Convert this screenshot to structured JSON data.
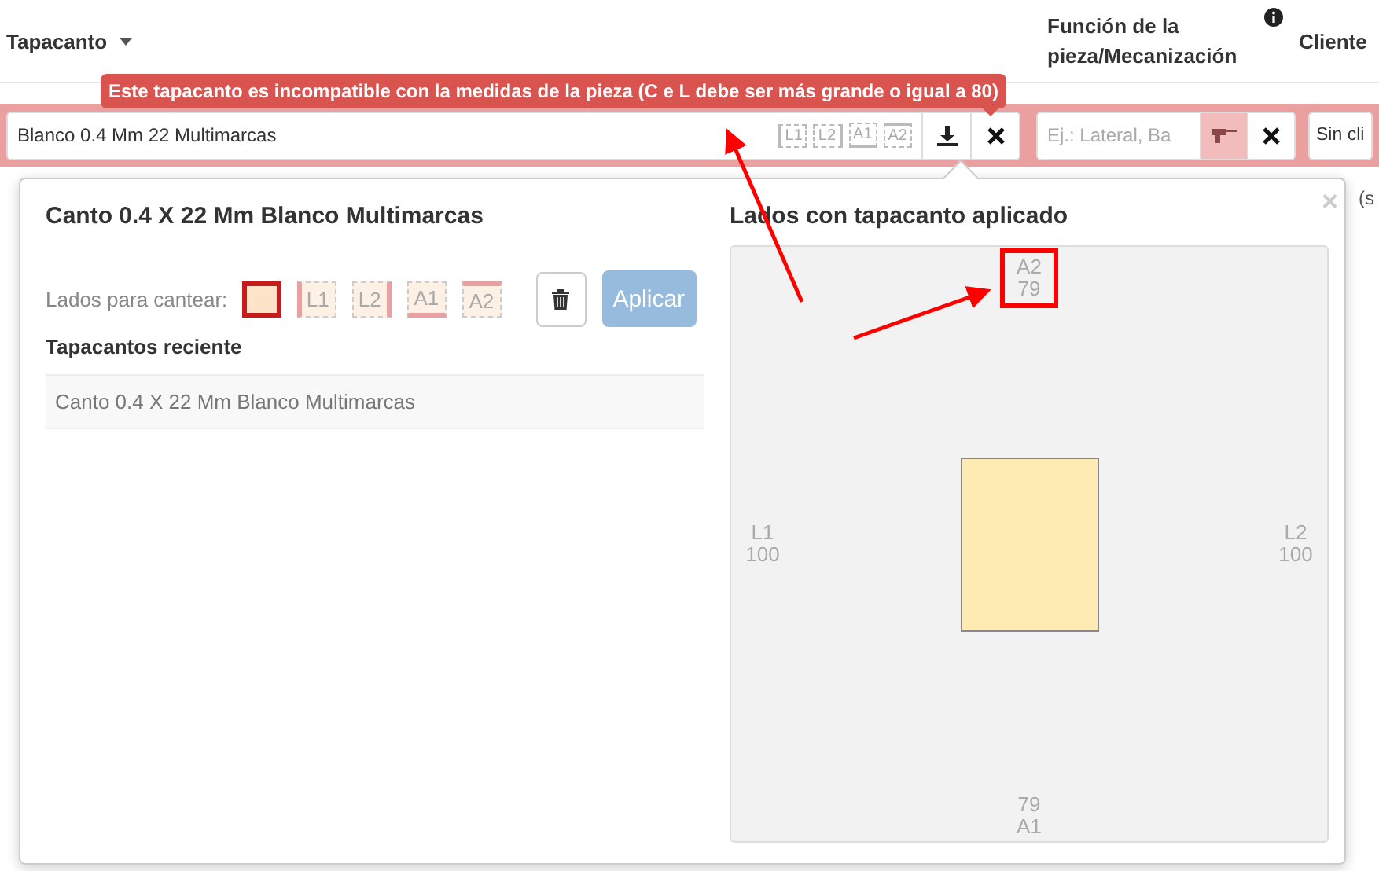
{
  "header": {
    "columns": [
      {
        "label": "Tapacanto",
        "kind": "sortable"
      },
      {
        "label": "Función de la pieza/Mecanización",
        "kind": "info"
      },
      {
        "label": "Cliente",
        "kind": "plain"
      }
    ]
  },
  "error_tooltip": "Este tapacanto es incompatible con la medidas de la pieza (C e L debe ser más grande o igual a 80)",
  "edge_field": {
    "value": "Blanco 0.4 Mm 22 Multimarcas",
    "side_chips": [
      "L1",
      "L2",
      "A1",
      "A2"
    ]
  },
  "function_field": {
    "placeholder": "Ej.: Lateral, Ba"
  },
  "client_select": {
    "value": "Sin cli"
  },
  "behind_text": "(s",
  "popup": {
    "close": "×",
    "title": "Canto 0.4 X 22 Mm Blanco Multimarcas",
    "sides_label": "Lados para cantear:",
    "sides": [
      {
        "kind": "all",
        "selected": true
      },
      {
        "kind": "left",
        "label": "L1",
        "selected": false
      },
      {
        "kind": "right",
        "label": "L2",
        "selected": false
      },
      {
        "kind": "bottom",
        "label": "A1",
        "selected": false
      },
      {
        "kind": "top",
        "label": "A2",
        "selected": false
      }
    ],
    "apply_button": {
      "label": "Aplicar",
      "disabled": true
    },
    "recent_title": "Tapacantos reciente",
    "recent": [
      "Canto 0.4 X 22 Mm Blanco Multimarcas"
    ],
    "preview": {
      "title": "Lados con tapacanto aplicado",
      "top": {
        "label": "A2",
        "value": "79",
        "highlighted": true
      },
      "left": {
        "label": "L1",
        "value": "100",
        "highlighted": false
      },
      "right": {
        "label": "L2",
        "value": "100",
        "highlighted": false
      },
      "bottom": {
        "label": "A1",
        "value": "79",
        "highlighted": false
      }
    }
  }
}
